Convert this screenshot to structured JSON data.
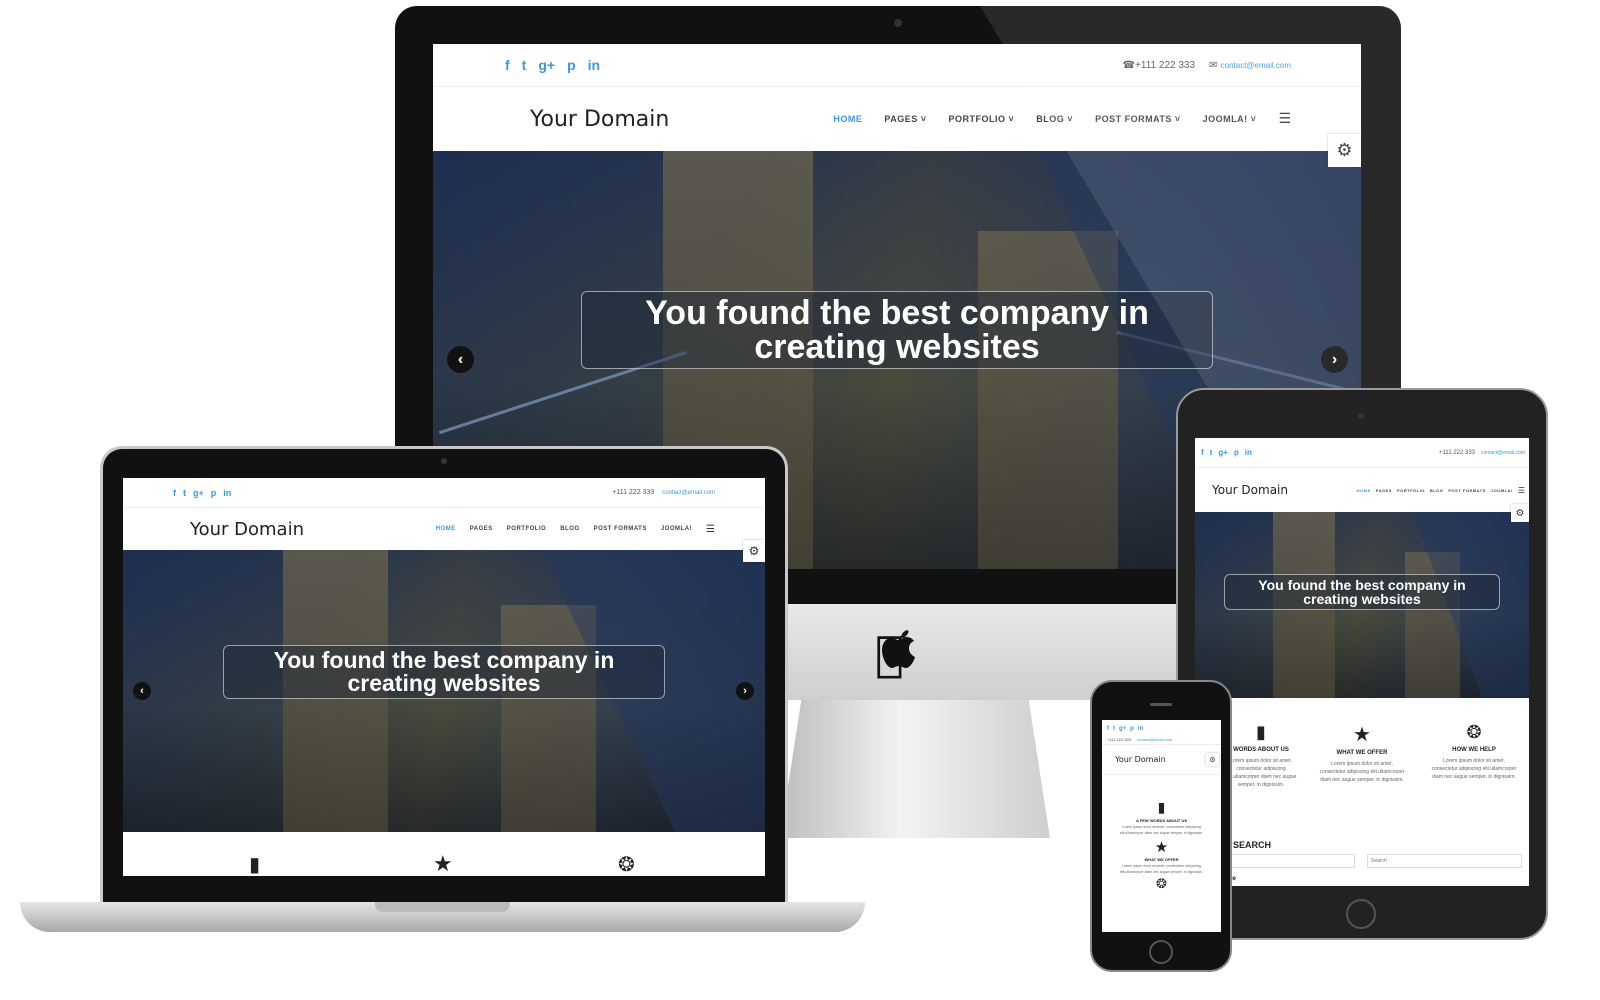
{
  "site": {
    "brand": "Your Domain",
    "phone": "+111 222 333",
    "email": "contact@email.com",
    "social": [
      "f",
      "t",
      "g+",
      "p",
      "in"
    ],
    "menu": [
      {
        "label": "HOME",
        "active": true
      },
      {
        "label": "PAGES",
        "caret": true
      },
      {
        "label": "PORTFOLIO",
        "caret": true
      },
      {
        "label": "BLOG",
        "caret": true
      },
      {
        "label": "POST FORMATS",
        "caret": true
      },
      {
        "label": "JOOMLA!",
        "caret": true
      }
    ],
    "hero_caption_line1": "You found the best company in",
    "hero_caption_line2": "creating websites",
    "accent_color": "#3a9ad9"
  },
  "features": [
    {
      "icon": "bookmark-icon",
      "title": "A FEW WORDS ABOUT US",
      "title_short": "WORDS ABOUT US",
      "text": "Lorem ipsum dolor sit amet, consectetur adipiscing elit.ullamcorper diam nec augue semper, in dignissim."
    },
    {
      "icon": "star-icon",
      "title": "WHAT WE OFFER",
      "text": "Lorem ipsum dolor sit amet, consectetur adipiscing elit.ullamcorper diam nec augue semper, in dignissim."
    },
    {
      "icon": "rebel-icon",
      "title": "HOW WE HELP",
      "text": "Lorem ipsum dolor sit amet, consectetur adipiscing elit.ullamcorper diam nec augue semper, in dignissim."
    }
  ],
  "ipad_extra": {
    "search_heading": "SEARCH",
    "search_placeholder": "Search",
    "partial_text": "ge"
  }
}
